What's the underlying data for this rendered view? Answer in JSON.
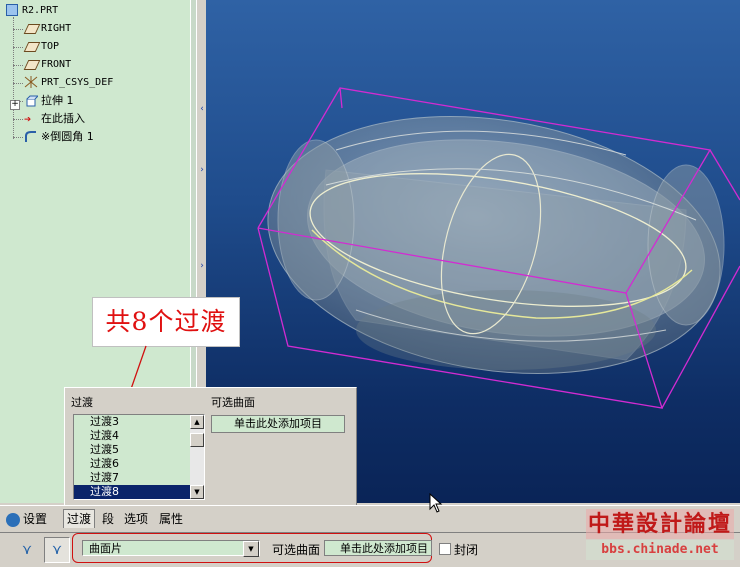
{
  "model_tree": {
    "root": "R2.PRT",
    "items": [
      {
        "label": "RIGHT",
        "icon": "datum-plane-icon"
      },
      {
        "label": "TOP",
        "icon": "datum-plane-icon"
      },
      {
        "label": "FRONT",
        "icon": "datum-plane-icon"
      },
      {
        "label": "PRT_CSYS_DEF",
        "icon": "csys-icon"
      },
      {
        "label": "拉伸 1",
        "icon": "extrude-icon"
      },
      {
        "label": "在此插入",
        "icon": "insert-arrow-icon"
      },
      {
        "label": "※倒圆角 1",
        "icon": "round-icon"
      }
    ]
  },
  "callout": {
    "text": "共8个过渡"
  },
  "transitions_panel": {
    "title": "过渡",
    "items": [
      "过渡3",
      "过渡4",
      "过渡5",
      "过渡6",
      "过渡7",
      "过渡8"
    ],
    "selected": "过渡8",
    "optional_surfaces_title": "可选曲面",
    "add_item_text": "单击此处添加项目"
  },
  "tabs": [
    {
      "label": "设置",
      "active": false
    },
    {
      "label": "过渡",
      "active": true
    },
    {
      "label": "段",
      "active": false
    },
    {
      "label": "选项",
      "active": false
    },
    {
      "label": "属性",
      "active": false
    }
  ],
  "dashboard": {
    "type_value": "曲面片",
    "optional_surfaces_label": "可选曲面",
    "add_item_text": "单击此处添加项目",
    "close_label": "封闭",
    "close_checked": false
  },
  "watermark": {
    "top": "中華設計論壇",
    "bottom": "bbs.chinade.net"
  },
  "colors": {
    "tree_bg": "#cfe8cf",
    "selection": "#0a246a",
    "callout_text": "#e01010",
    "highlight_outline": "#d01010",
    "bbox": "#d22bd2"
  }
}
